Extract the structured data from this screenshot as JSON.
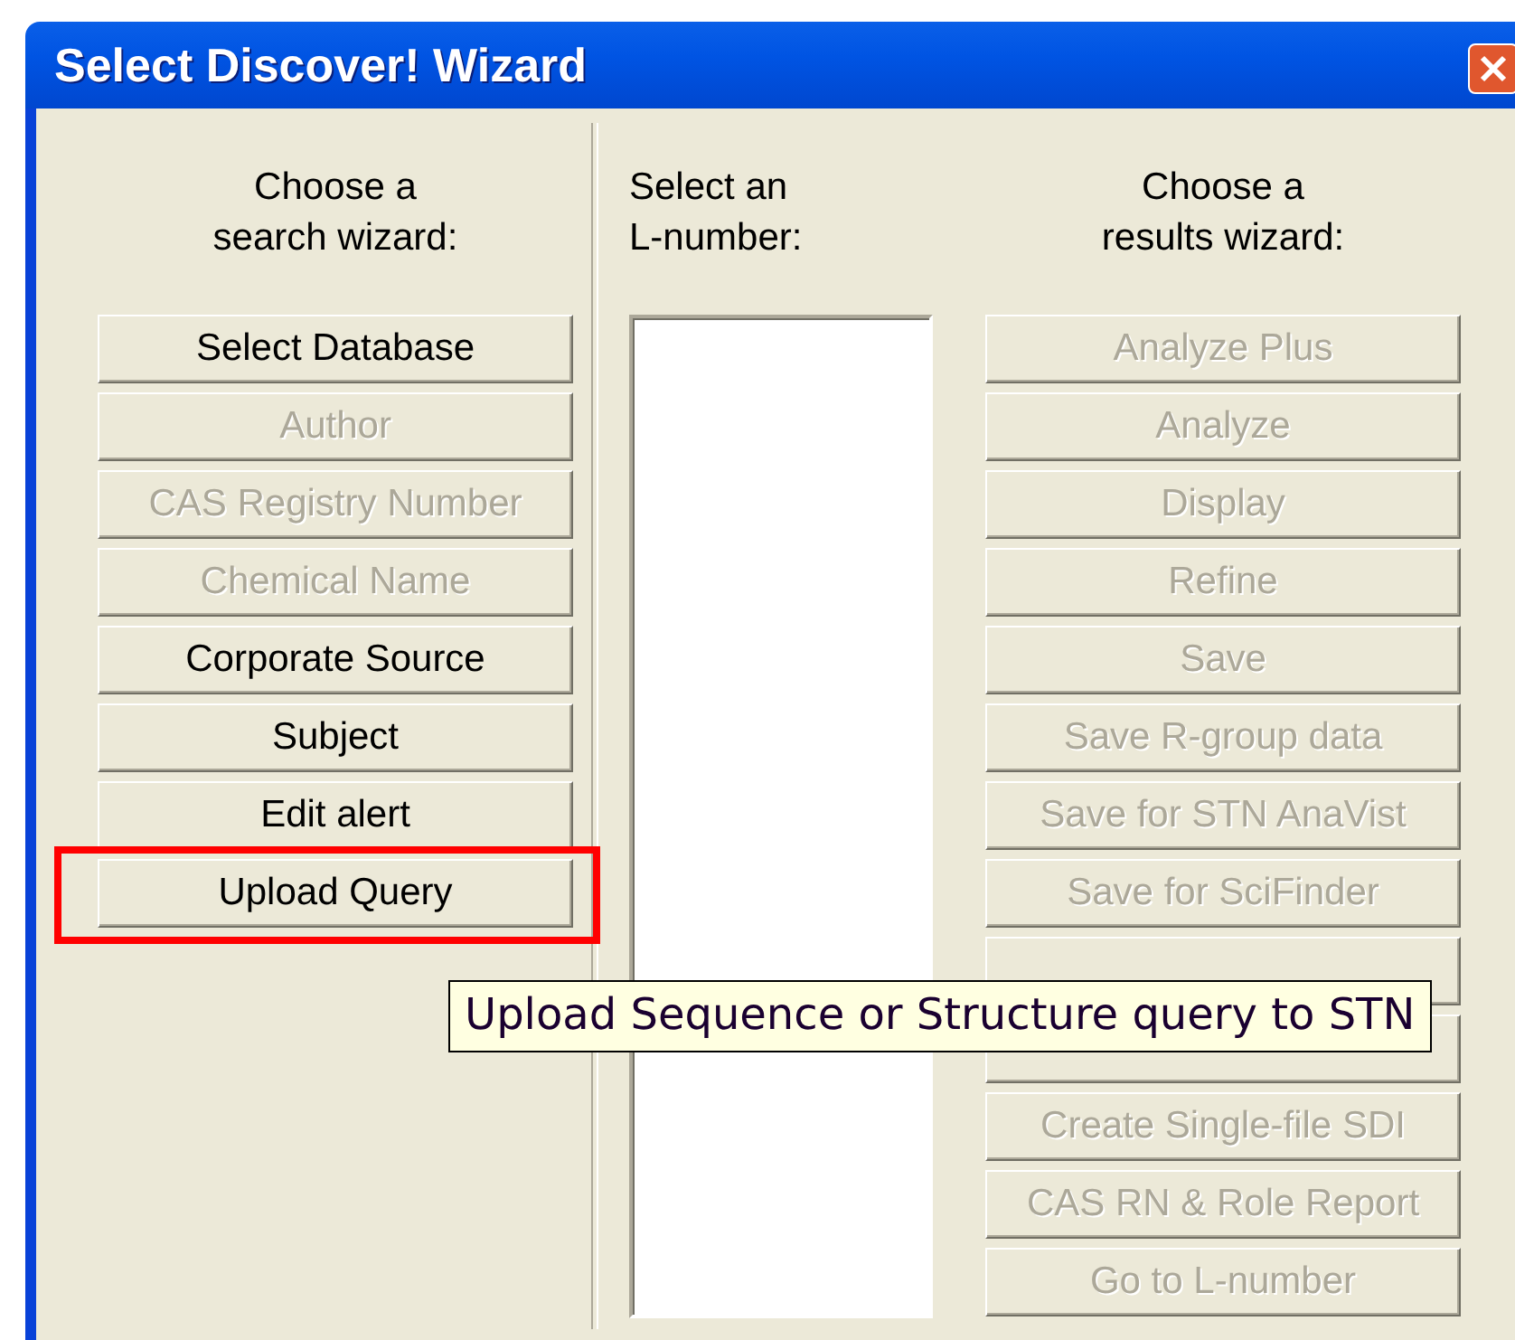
{
  "window": {
    "title": "Select Discover! Wizard"
  },
  "search_wizards": {
    "heading": "Choose a\nsearch wizard:",
    "buttons": [
      {
        "label": "Select Database",
        "disabled": false,
        "highlighted": false
      },
      {
        "label": "Author",
        "disabled": true,
        "highlighted": false
      },
      {
        "label": "CAS Registry Number",
        "disabled": true,
        "highlighted": false
      },
      {
        "label": "Chemical Name",
        "disabled": true,
        "highlighted": false
      },
      {
        "label": "Corporate Source",
        "disabled": false,
        "highlighted": false
      },
      {
        "label": "Subject",
        "disabled": false,
        "highlighted": false
      },
      {
        "label": "Edit alert",
        "disabled": false,
        "highlighted": false
      },
      {
        "label": "Upload Query",
        "disabled": false,
        "highlighted": true
      }
    ]
  },
  "l_numbers": {
    "heading": "Select an\nL-number:"
  },
  "results_wizards": {
    "heading": "Choose a\nresults wizard:",
    "buttons": [
      {
        "kind": "labeled",
        "label": "Analyze Plus",
        "disabled": true
      },
      {
        "kind": "labeled",
        "label": "Analyze",
        "disabled": true
      },
      {
        "kind": "labeled",
        "label": "Display",
        "disabled": true
      },
      {
        "kind": "labeled",
        "label": "Refine",
        "disabled": true
      },
      {
        "kind": "labeled",
        "label": "Save",
        "disabled": true
      },
      {
        "kind": "labeled",
        "label": "Save R-group data",
        "disabled": true
      },
      {
        "kind": "labeled",
        "label": "Save for STN AnaVist",
        "disabled": true
      },
      {
        "kind": "labeled",
        "label": "Save for SciFinder",
        "disabled": true
      },
      {
        "kind": "covered"
      },
      {
        "kind": "covered"
      },
      {
        "kind": "labeled",
        "label": "Create Single-file SDI",
        "disabled": true
      },
      {
        "kind": "labeled",
        "label": "CAS RN & Role Report",
        "disabled": true
      },
      {
        "kind": "labeled",
        "label": "Go to L-number",
        "disabled": true
      }
    ]
  },
  "tooltip": {
    "text": "Upload Sequence or Structure query to STN"
  }
}
